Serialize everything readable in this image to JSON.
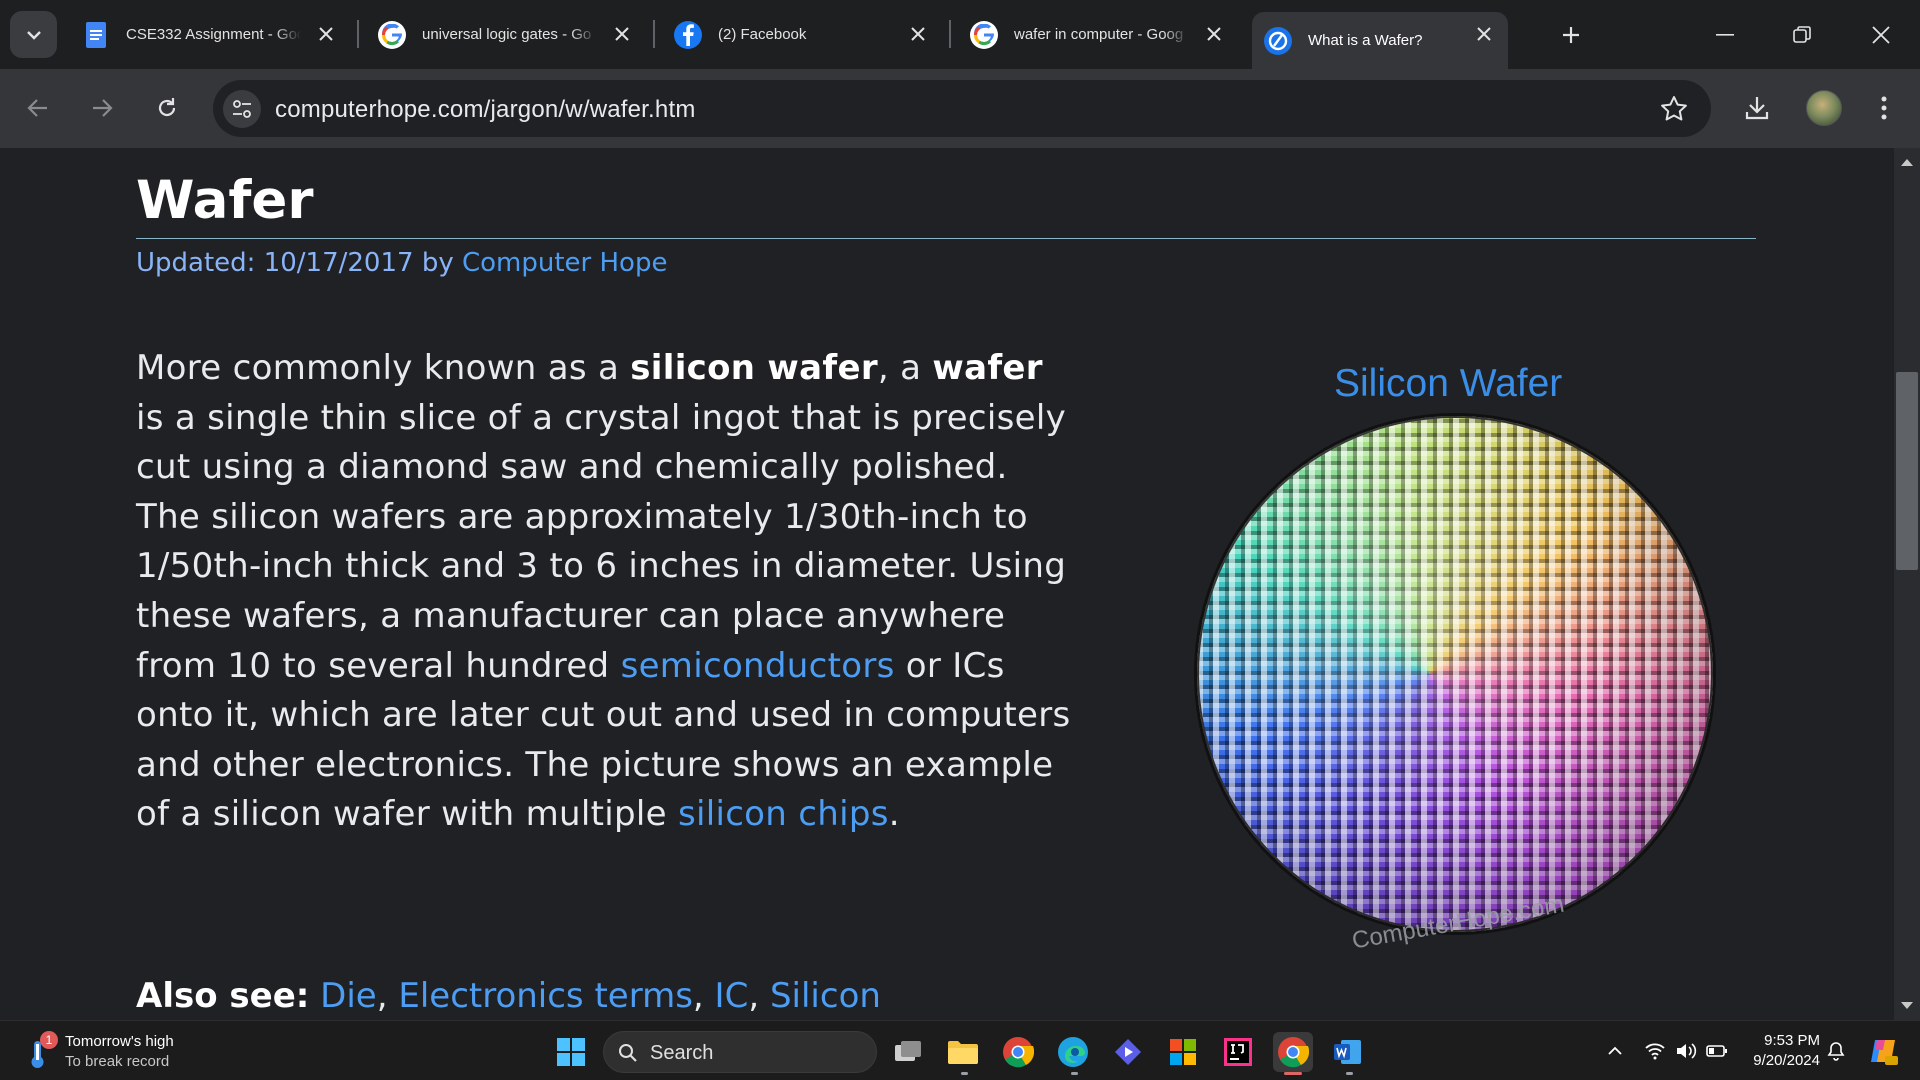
{
  "browser": {
    "tabs": [
      {
        "title": "CSE332 Assignment - Goo",
        "favicon": "google-docs-icon",
        "active": false
      },
      {
        "title": "universal logic gates - Go",
        "favicon": "google-icon",
        "active": false
      },
      {
        "title": "(2) Facebook",
        "favicon": "facebook-icon",
        "active": false
      },
      {
        "title": "wafer in computer - Goog",
        "favicon": "google-icon",
        "active": false
      },
      {
        "title": "What is a Wafer?",
        "favicon": "computerhope-icon",
        "active": true
      }
    ],
    "url": "computerhope.com/jargon/w/wafer.htm"
  },
  "article": {
    "title": "Wafer",
    "updated_label": "Updated:",
    "updated_date": "10/17/2017",
    "by_label": "by",
    "author": "Computer Hope",
    "p1": "More commonly known as a ",
    "bold1": "silicon wafer",
    "p2": ", a ",
    "bold2": "wafer",
    "p3": " is a single thin slice of a crystal ingot that is precisely cut using a diamond saw and chemically polished. The silicon wafers are approximately 1/30th-inch to 1/50th-inch thick and 3 to 6 inches in diameter. Using these wafers, a manufacturer can place anywhere from 10 to several hundred ",
    "link_semiconductors": "semiconductors",
    "p4": " or ICs onto it, which are later cut out and used in computers and other electronics. The picture shows an example of a silicon wafer with multiple ",
    "link_chips": "silicon chips",
    "p5": ".",
    "also_see_label": "Also see:",
    "also_see": [
      "Die",
      "Electronics terms",
      "IC",
      "Silicon"
    ],
    "sep": ", ",
    "figure_title": "Silicon Wafer",
    "watermark": "ComputerHope.com"
  },
  "taskbar": {
    "weather_line1": "Tomorrow's high",
    "weather_line2": "To break record",
    "weather_badge": "1",
    "search_label": "Search",
    "time": "9:53 PM",
    "date": "9/20/2024"
  },
  "colors": {
    "link": "#4d9df2",
    "background": "#202124",
    "figure_title": "#3b8ee8"
  }
}
